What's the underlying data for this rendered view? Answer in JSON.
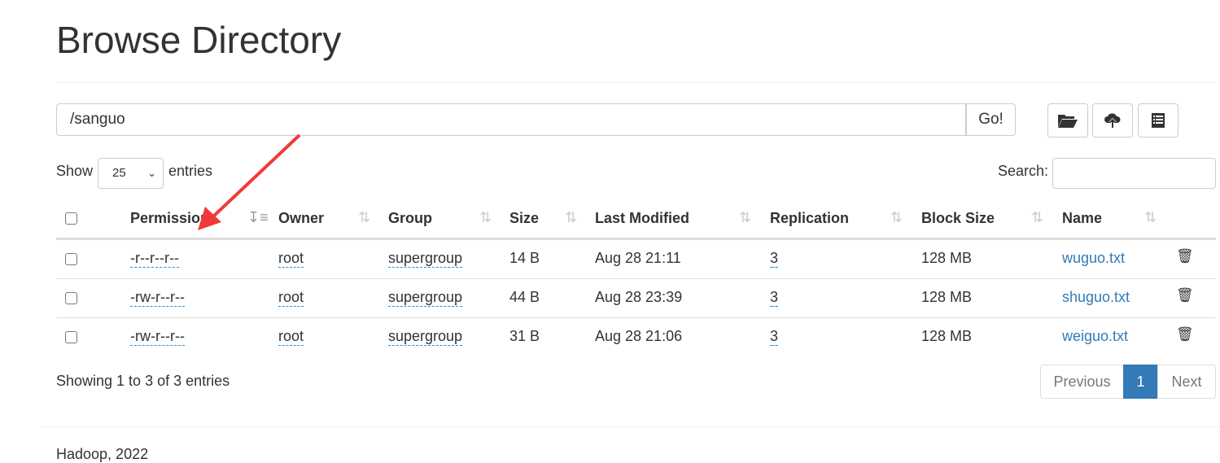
{
  "page_title": "Browse Directory",
  "path_input": {
    "value": "/sanguo"
  },
  "go_label": "Go!",
  "toolbar": {
    "icons": [
      "folder-open-icon",
      "cloud-upload-icon",
      "list-icon"
    ]
  },
  "length": {
    "show": "Show",
    "value": "25",
    "entries": "entries"
  },
  "search": {
    "label": "Search:",
    "value": ""
  },
  "columns": [
    "Permission",
    "Owner",
    "Group",
    "Size",
    "Last Modified",
    "Replication",
    "Block Size",
    "Name"
  ],
  "rows": [
    {
      "permission": "-r--r--r--",
      "owner": "root",
      "group": "supergroup",
      "size": "14 B",
      "modified": "Aug 28 21:11",
      "replication": "3",
      "block_size": "128 MB",
      "name": "wuguo.txt"
    },
    {
      "permission": "-rw-r--r--",
      "owner": "root",
      "group": "supergroup",
      "size": "44 B",
      "modified": "Aug 28 23:39",
      "replication": "3",
      "block_size": "128 MB",
      "name": "shuguo.txt"
    },
    {
      "permission": "-rw-r--r--",
      "owner": "root",
      "group": "supergroup",
      "size": "31 B",
      "modified": "Aug 28 21:06",
      "replication": "3",
      "block_size": "128 MB",
      "name": "weiguo.txt"
    }
  ],
  "info": "Showing 1 to 3 of 3 entries",
  "pagination": {
    "previous": "Previous",
    "current": "1",
    "next": "Next"
  },
  "footer": "Hadoop, 2022",
  "colors": {
    "link": "#337ab7",
    "active_page": "#337ab7",
    "annotation_arrow": "#f03a3a"
  }
}
